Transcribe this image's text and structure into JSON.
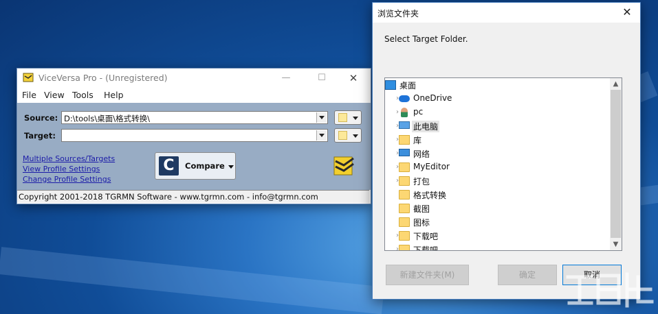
{
  "viceversa": {
    "title": "ViceVersa Pro - (Unregistered)",
    "controls": {
      "minimize": "—",
      "maximize": "☐",
      "close": "✕"
    },
    "menu": [
      "File",
      "View",
      "Tools",
      "Help"
    ],
    "source_label": "Source:",
    "source_value": "D:\\tools\\桌面\\格式转换\\",
    "target_label": "Target:",
    "target_value": "",
    "links": [
      "Multiple Sources/Targets",
      "View Profile Settings",
      "Change Profile Settings"
    ],
    "compare_label": "Compare",
    "compare_icon_letter": "C",
    "status": "Copyright 2001-2018 TGRMN Software - www.tgrmn.com - info@tgrmn.com"
  },
  "browse_dialog": {
    "title": "浏览文件夹",
    "close": "✕",
    "prompt": "Select Target Folder.",
    "tree": [
      {
        "label": "桌面",
        "icon": "desktop-icon",
        "indent": 0,
        "expander": false,
        "selected": false
      },
      {
        "label": "OneDrive",
        "icon": "cloud-icon",
        "indent": 1,
        "expander": true,
        "selected": false
      },
      {
        "label": "pc",
        "icon": "user-icon",
        "indent": 1,
        "expander": true,
        "selected": false
      },
      {
        "label": "此电脑",
        "icon": "computer-icon",
        "indent": 1,
        "expander": true,
        "selected": true
      },
      {
        "label": "库",
        "icon": "library-icon",
        "indent": 1,
        "expander": true,
        "selected": false
      },
      {
        "label": "网络",
        "icon": "network-icon",
        "indent": 1,
        "expander": true,
        "selected": false
      },
      {
        "label": "MyEditor",
        "icon": "folder-icon",
        "indent": 1,
        "expander": true,
        "selected": false
      },
      {
        "label": "打包",
        "icon": "folder-icon",
        "indent": 1,
        "expander": true,
        "selected": false
      },
      {
        "label": "格式转换",
        "icon": "folder-icon",
        "indent": 1,
        "expander": false,
        "selected": false
      },
      {
        "label": "截图",
        "icon": "folder-icon",
        "indent": 1,
        "expander": false,
        "selected": false
      },
      {
        "label": "图标",
        "icon": "folder-icon",
        "indent": 1,
        "expander": false,
        "selected": false
      },
      {
        "label": "下载吧",
        "icon": "folder-icon",
        "indent": 1,
        "expander": true,
        "selected": false
      },
      {
        "label": "下载吧",
        "icon": "folder-icon",
        "indent": 1,
        "expander": true,
        "selected": false
      }
    ],
    "buttons": {
      "new_folder": "新建文件夹(M)",
      "ok": "确定",
      "cancel": "取消"
    }
  },
  "colors": {
    "accent": "#0078d7",
    "link": "#1b1ba8",
    "panel": "#98acc4"
  }
}
